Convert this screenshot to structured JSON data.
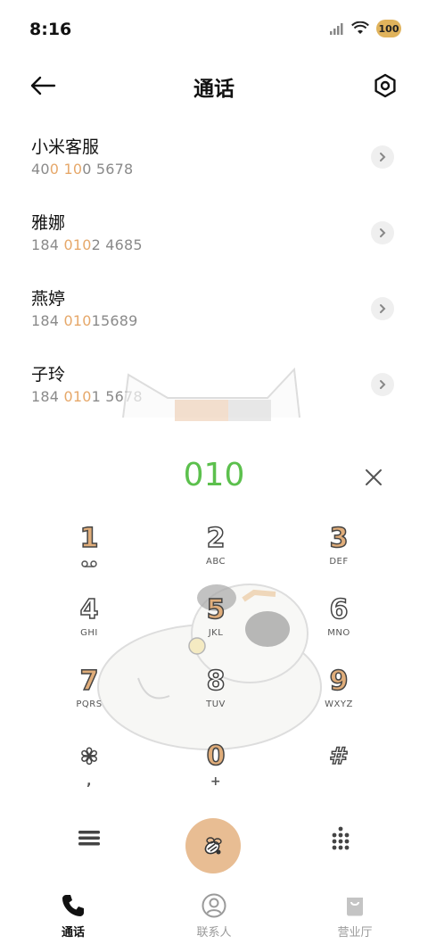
{
  "status_bar": {
    "time": "8:16",
    "battery": "100"
  },
  "header": {
    "title": "通话"
  },
  "contacts": [
    {
      "name": "小米客服",
      "number_parts": [
        "40",
        "0",
        " ",
        "10",
        "0 5678"
      ]
    },
    {
      "name": "雅娜",
      "number_parts": [
        "184 ",
        "010",
        "2 4685"
      ]
    },
    {
      "name": "燕婷",
      "number_parts": [
        "184 ",
        "010",
        "15689"
      ]
    },
    {
      "name": "子玲",
      "number_parts": [
        "184 ",
        "010",
        "1 5678"
      ]
    }
  ],
  "dial": {
    "entered": "010"
  },
  "keypad": [
    {
      "digit": "1",
      "sub": ""
    },
    {
      "digit": "2",
      "sub": "ABC"
    },
    {
      "digit": "3",
      "sub": "DEF"
    },
    {
      "digit": "4",
      "sub": "GHI"
    },
    {
      "digit": "5",
      "sub": "JKL"
    },
    {
      "digit": "6",
      "sub": "MNO"
    },
    {
      "digit": "7",
      "sub": "PQRS"
    },
    {
      "digit": "8",
      "sub": "TUV"
    },
    {
      "digit": "9",
      "sub": "WXYZ"
    },
    {
      "digit": "✽",
      "sub": ","
    },
    {
      "digit": "0",
      "sub": "+"
    },
    {
      "digit": "#",
      "sub": ""
    }
  ],
  "tabs": [
    {
      "label": "通话",
      "icon": "phone-icon",
      "active": true
    },
    {
      "label": "联系人",
      "icon": "person-icon",
      "active": false
    },
    {
      "label": "营业厅",
      "icon": "bag-icon",
      "active": false
    }
  ],
  "colors": {
    "accent_green": "#5cc04d",
    "highlight_orange": "#e6a86a",
    "call_button": "#e8bd93"
  }
}
